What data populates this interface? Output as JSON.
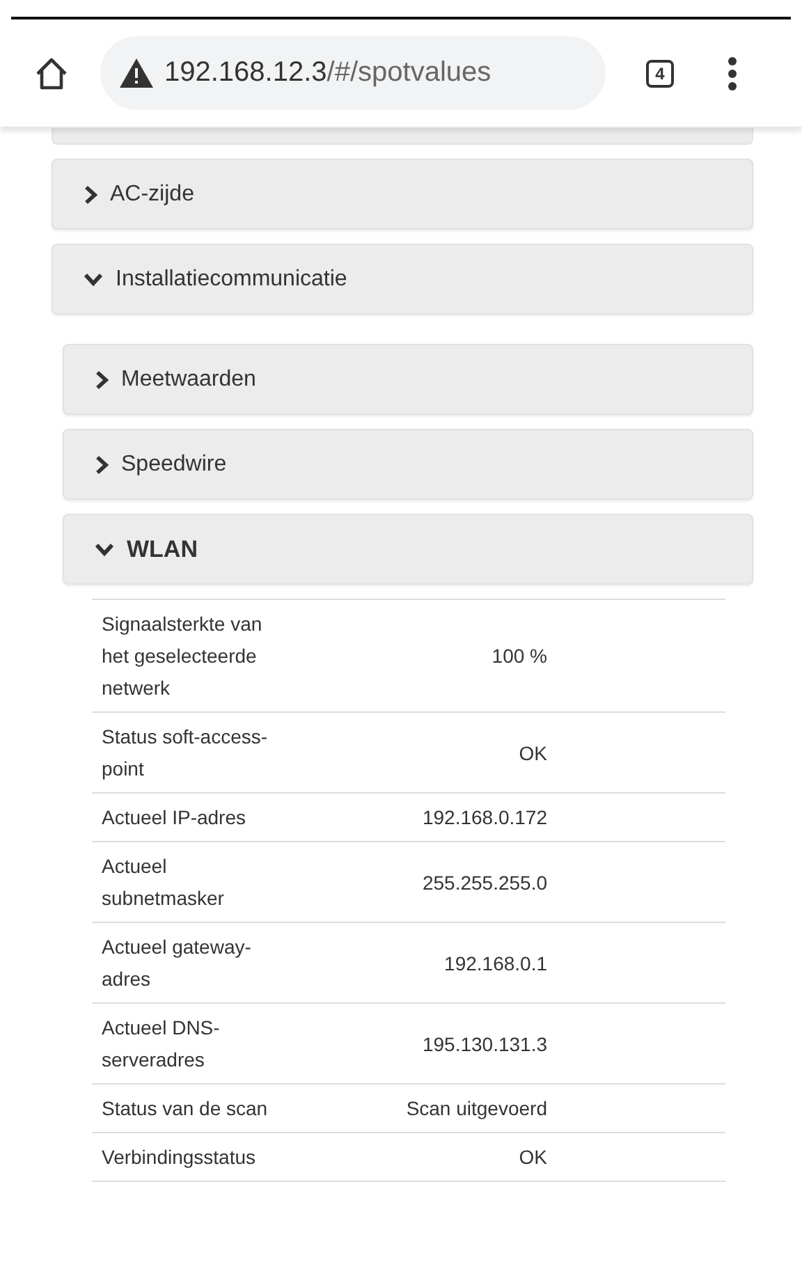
{
  "browser_toolbar": {
    "insecure": true,
    "url_host": "192.168.12.3",
    "url_path": "/#/spotvalues",
    "tab_count": "4"
  },
  "sections": [
    {
      "label": "AC-zijde",
      "expanded": false
    },
    {
      "label": "Installatiecommunicatie",
      "expanded": true,
      "children": [
        {
          "label": "Meetwaarden",
          "expanded": false
        },
        {
          "label": "Speedwire",
          "expanded": false
        },
        {
          "label": "WLAN",
          "expanded": true,
          "rows": [
            {
              "label": "Signaalsterkte van het geselecteerde netwerk",
              "value": "100 %"
            },
            {
              "label": "Status soft-access-point",
              "value": "OK"
            },
            {
              "label": "Actueel IP-adres",
              "value": "192.168.0.172"
            },
            {
              "label": "Actueel subnetmasker",
              "value": "255.255.255.0"
            },
            {
              "label": "Actueel gateway-adres",
              "value": "192.168.0.1"
            },
            {
              "label": "Actueel DNS-serveradres",
              "value": "195.130.131.3"
            },
            {
              "label": "Status van de scan",
              "value": "Scan uitgevoerd"
            },
            {
              "label": "Verbindingsstatus",
              "value": "OK"
            }
          ]
        }
      ]
    }
  ]
}
